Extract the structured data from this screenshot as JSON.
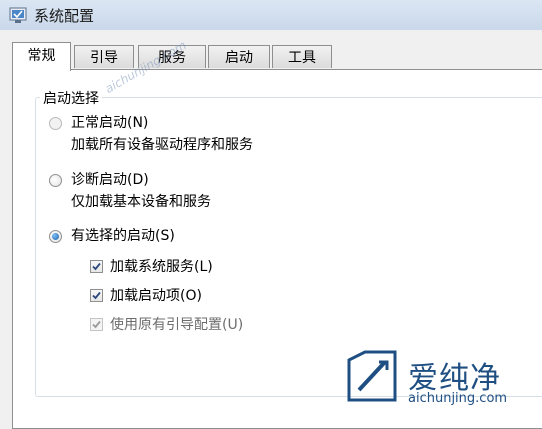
{
  "window": {
    "title": "系统配置"
  },
  "tabs": [
    {
      "label": "常规",
      "active": true
    },
    {
      "label": "引导",
      "active": false
    },
    {
      "label": "服务",
      "active": false
    },
    {
      "label": "启动",
      "active": false
    },
    {
      "label": "工具",
      "active": false
    }
  ],
  "startup": {
    "group_title": "启动选择",
    "options": [
      {
        "label": "正常启动(N)",
        "desc": "加载所有设备驱动程序和服务",
        "checked": false,
        "enabled": false
      },
      {
        "label": "诊断启动(D)",
        "desc": "仅加载基本设备和服务",
        "checked": false,
        "enabled": true
      },
      {
        "label": "有选择的启动(S)",
        "checked": true,
        "enabled": true
      }
    ],
    "checks": [
      {
        "label": "加载系统服务(L)",
        "checked": true,
        "enabled": true
      },
      {
        "label": "加载启动项(O)",
        "checked": true,
        "enabled": true
      },
      {
        "label": "使用原有引导配置(U)",
        "checked": true,
        "enabled": false
      }
    ]
  },
  "watermark": {
    "site": "aichunjing.com",
    "brand": "爱纯净",
    "url": "aichunjing.com"
  },
  "colors": {
    "titlebar": "#c9d8ea",
    "accent": "#1c5fa8",
    "watermark": "#1f4f82"
  }
}
